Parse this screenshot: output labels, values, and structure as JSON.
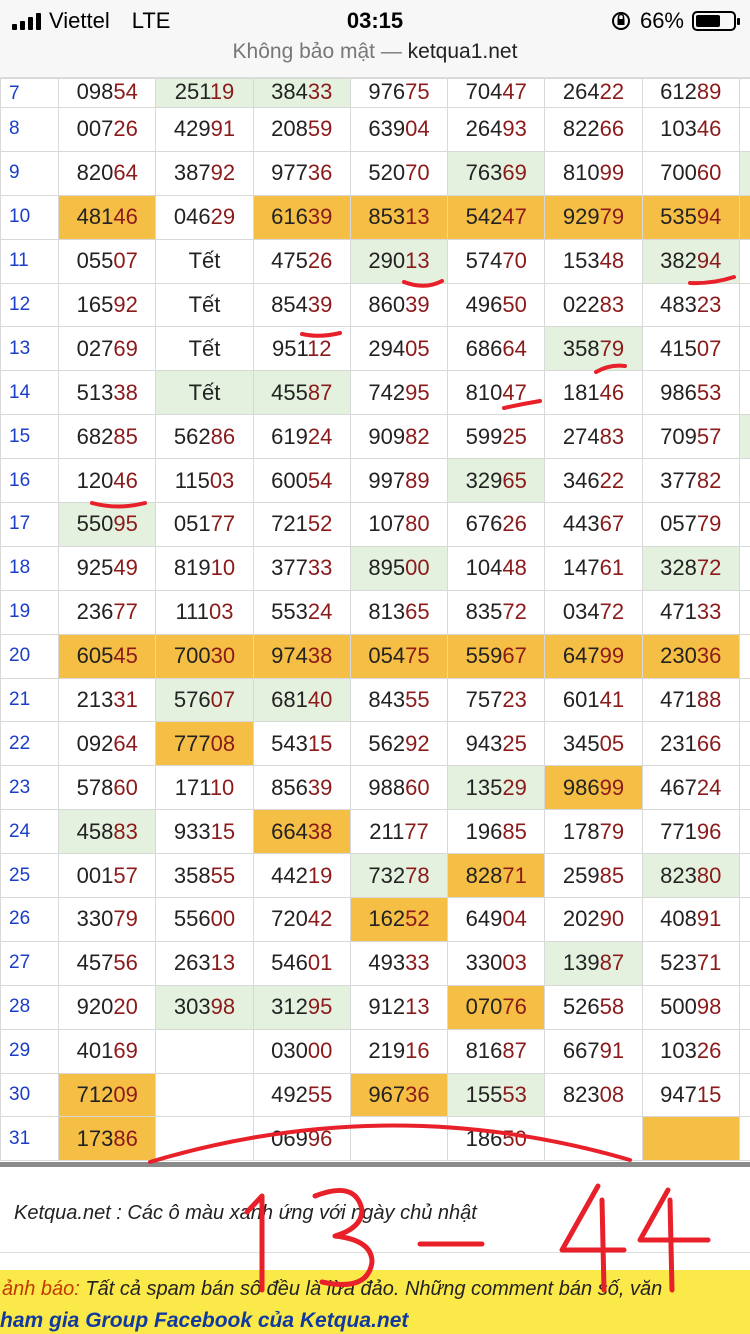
{
  "status_bar": {
    "carrier": "Viettel",
    "network": "LTE",
    "time": "03:15",
    "battery": "66%",
    "battery_level": 0.66
  },
  "url_bar": {
    "security": "Không bảo mật —",
    "host": "ketqua1.net"
  },
  "table": {
    "rows": [
      {
        "day": "7",
        "cells": [
          [
            "098",
            "54",
            ""
          ],
          [
            "251",
            "19",
            "g"
          ],
          [
            "384",
            "33",
            "g"
          ],
          [
            "976",
            "75",
            ""
          ],
          [
            "704",
            "47",
            ""
          ],
          [
            "264",
            "22",
            ""
          ],
          [
            "612",
            "89",
            ""
          ]
        ]
      },
      {
        "day": "8",
        "cells": [
          [
            "007",
            "26",
            ""
          ],
          [
            "429",
            "91",
            ""
          ],
          [
            "208",
            "59",
            ""
          ],
          [
            "639",
            "04",
            ""
          ],
          [
            "264",
            "93",
            ""
          ],
          [
            "822",
            "66",
            ""
          ],
          [
            "103",
            "46",
            ""
          ]
        ]
      },
      {
        "day": "9",
        "cells": [
          [
            "820",
            "64",
            ""
          ],
          [
            "387",
            "92",
            ""
          ],
          [
            "977",
            "36",
            ""
          ],
          [
            "520",
            "70",
            ""
          ],
          [
            "763",
            "69",
            "g"
          ],
          [
            "810",
            "99",
            ""
          ],
          [
            "700",
            "60",
            ""
          ]
        ]
      },
      {
        "day": "10",
        "cells": [
          [
            "481",
            "46",
            "y"
          ],
          [
            "046",
            "29",
            ""
          ],
          [
            "616",
            "39",
            "y"
          ],
          [
            "853",
            "13",
            "y"
          ],
          [
            "542",
            "47",
            "y"
          ],
          [
            "929",
            "79",
            "y"
          ],
          [
            "535",
            "94",
            "y"
          ]
        ]
      },
      {
        "day": "11",
        "cells": [
          [
            "055",
            "07",
            ""
          ],
          [
            "Tết",
            "",
            "t"
          ],
          [
            "475",
            "26",
            ""
          ],
          [
            "290",
            "13",
            "g"
          ],
          [
            "574",
            "70",
            ""
          ],
          [
            "153",
            "48",
            ""
          ],
          [
            "382",
            "94",
            "g"
          ]
        ]
      },
      {
        "day": "12",
        "cells": [
          [
            "165",
            "92",
            ""
          ],
          [
            "Tết",
            "",
            "t"
          ],
          [
            "854",
            "39",
            ""
          ],
          [
            "860",
            "39",
            ""
          ],
          [
            "496",
            "50",
            ""
          ],
          [
            "022",
            "83",
            ""
          ],
          [
            "483",
            "23",
            ""
          ]
        ]
      },
      {
        "day": "13",
        "cells": [
          [
            "027",
            "69",
            ""
          ],
          [
            "Tết",
            "",
            "t"
          ],
          [
            "951",
            "12",
            ""
          ],
          [
            "294",
            "05",
            ""
          ],
          [
            "686",
            "64",
            ""
          ],
          [
            "358",
            "79",
            "g"
          ],
          [
            "415",
            "07",
            ""
          ]
        ]
      },
      {
        "day": "14",
        "cells": [
          [
            "513",
            "38",
            ""
          ],
          [
            "Tết",
            "",
            "tg"
          ],
          [
            "455",
            "87",
            "g"
          ],
          [
            "742",
            "95",
            ""
          ],
          [
            "810",
            "47",
            ""
          ],
          [
            "181",
            "46",
            ""
          ],
          [
            "986",
            "53",
            ""
          ]
        ]
      },
      {
        "day": "15",
        "cells": [
          [
            "682",
            "85",
            ""
          ],
          [
            "562",
            "86",
            ""
          ],
          [
            "619",
            "24",
            ""
          ],
          [
            "909",
            "82",
            ""
          ],
          [
            "599",
            "25",
            ""
          ],
          [
            "274",
            "83",
            ""
          ],
          [
            "709",
            "57",
            ""
          ]
        ]
      },
      {
        "day": "16",
        "cells": [
          [
            "120",
            "46",
            ""
          ],
          [
            "115",
            "03",
            ""
          ],
          [
            "600",
            "54",
            ""
          ],
          [
            "997",
            "89",
            ""
          ],
          [
            "329",
            "65",
            "g"
          ],
          [
            "346",
            "22",
            ""
          ],
          [
            "377",
            "82",
            ""
          ]
        ]
      },
      {
        "day": "17",
        "cells": [
          [
            "550",
            "95",
            "g"
          ],
          [
            "051",
            "77",
            ""
          ],
          [
            "721",
            "52",
            ""
          ],
          [
            "107",
            "80",
            ""
          ],
          [
            "676",
            "26",
            ""
          ],
          [
            "443",
            "67",
            ""
          ],
          [
            "057",
            "79",
            ""
          ]
        ]
      },
      {
        "day": "18",
        "cells": [
          [
            "925",
            "49",
            ""
          ],
          [
            "819",
            "10",
            ""
          ],
          [
            "377",
            "33",
            ""
          ],
          [
            "895",
            "00",
            "g"
          ],
          [
            "104",
            "48",
            ""
          ],
          [
            "147",
            "61",
            ""
          ],
          [
            "328",
            "72",
            "g"
          ]
        ]
      },
      {
        "day": "19",
        "cells": [
          [
            "236",
            "77",
            ""
          ],
          [
            "111",
            "03",
            ""
          ],
          [
            "553",
            "24",
            ""
          ],
          [
            "813",
            "65",
            ""
          ],
          [
            "835",
            "72",
            ""
          ],
          [
            "034",
            "72",
            ""
          ],
          [
            "471",
            "33",
            ""
          ]
        ]
      },
      {
        "day": "20",
        "cells": [
          [
            "605",
            "45",
            "y"
          ],
          [
            "700",
            "30",
            "y"
          ],
          [
            "974",
            "38",
            "y"
          ],
          [
            "054",
            "75",
            "y"
          ],
          [
            "559",
            "67",
            "y"
          ],
          [
            "647",
            "99",
            "y"
          ],
          [
            "230",
            "36",
            "y"
          ]
        ]
      },
      {
        "day": "21",
        "cells": [
          [
            "213",
            "31",
            ""
          ],
          [
            "576",
            "07",
            "g"
          ],
          [
            "681",
            "40",
            "g"
          ],
          [
            "843",
            "55",
            ""
          ],
          [
            "757",
            "23",
            ""
          ],
          [
            "601",
            "41",
            ""
          ],
          [
            "471",
            "88",
            ""
          ]
        ]
      },
      {
        "day": "22",
        "cells": [
          [
            "092",
            "64",
            ""
          ],
          [
            "777",
            "08",
            "y"
          ],
          [
            "543",
            "15",
            ""
          ],
          [
            "562",
            "92",
            ""
          ],
          [
            "943",
            "25",
            ""
          ],
          [
            "345",
            "05",
            ""
          ],
          [
            "231",
            "66",
            ""
          ]
        ]
      },
      {
        "day": "23",
        "cells": [
          [
            "578",
            "60",
            ""
          ],
          [
            "171",
            "10",
            ""
          ],
          [
            "856",
            "39",
            ""
          ],
          [
            "988",
            "60",
            ""
          ],
          [
            "135",
            "29",
            "g"
          ],
          [
            "986",
            "99",
            "y"
          ],
          [
            "467",
            "24",
            ""
          ]
        ]
      },
      {
        "day": "24",
        "cells": [
          [
            "458",
            "83",
            "g"
          ],
          [
            "933",
            "15",
            ""
          ],
          [
            "664",
            "38",
            "y"
          ],
          [
            "211",
            "77",
            ""
          ],
          [
            "196",
            "85",
            ""
          ],
          [
            "178",
            "79",
            ""
          ],
          [
            "771",
            "96",
            ""
          ]
        ]
      },
      {
        "day": "25",
        "cells": [
          [
            "001",
            "57",
            ""
          ],
          [
            "358",
            "55",
            ""
          ],
          [
            "442",
            "19",
            ""
          ],
          [
            "732",
            "78",
            "g"
          ],
          [
            "828",
            "71",
            "y"
          ],
          [
            "259",
            "85",
            ""
          ],
          [
            "823",
            "80",
            "g"
          ]
        ]
      },
      {
        "day": "26",
        "cells": [
          [
            "330",
            "79",
            ""
          ],
          [
            "556",
            "00",
            ""
          ],
          [
            "720",
            "42",
            ""
          ],
          [
            "162",
            "52",
            "y"
          ],
          [
            "649",
            "04",
            ""
          ],
          [
            "202",
            "90",
            ""
          ],
          [
            "408",
            "91",
            ""
          ]
        ]
      },
      {
        "day": "27",
        "cells": [
          [
            "457",
            "56",
            ""
          ],
          [
            "263",
            "13",
            ""
          ],
          [
            "546",
            "01",
            ""
          ],
          [
            "493",
            "33",
            ""
          ],
          [
            "330",
            "03",
            ""
          ],
          [
            "139",
            "87",
            "g"
          ],
          [
            "523",
            "71",
            ""
          ]
        ]
      },
      {
        "day": "28",
        "cells": [
          [
            "920",
            "20",
            ""
          ],
          [
            "303",
            "98",
            "g"
          ],
          [
            "312",
            "95",
            "g"
          ],
          [
            "912",
            "13",
            ""
          ],
          [
            "070",
            "76",
            "y"
          ],
          [
            "526",
            "58",
            ""
          ],
          [
            "500",
            "98",
            ""
          ]
        ]
      },
      {
        "day": "29",
        "cells": [
          [
            "401",
            "69",
            ""
          ],
          [
            "",
            "",
            ""
          ],
          [
            "030",
            "00",
            ""
          ],
          [
            "219",
            "16",
            ""
          ],
          [
            "816",
            "87",
            ""
          ],
          [
            "667",
            "91",
            ""
          ],
          [
            "103",
            "26",
            ""
          ]
        ]
      },
      {
        "day": "30",
        "cells": [
          [
            "712",
            "09",
            "y"
          ],
          [
            "",
            "",
            ""
          ],
          [
            "492",
            "55",
            ""
          ],
          [
            "967",
            "36",
            "y"
          ],
          [
            "155",
            "53",
            "g"
          ],
          [
            "823",
            "08",
            ""
          ],
          [
            "947",
            "15",
            ""
          ]
        ]
      },
      {
        "day": "31",
        "cells": [
          [
            "173",
            "86",
            "y"
          ],
          [
            "",
            "",
            ""
          ],
          [
            "069",
            "96",
            ""
          ],
          [
            "",
            "",
            ""
          ],
          [
            "186",
            "50",
            ""
          ],
          [
            "",
            "",
            ""
          ],
          [
            "",
            "",
            "y"
          ]
        ]
      }
    ]
  },
  "footer": {
    "note": "Ketqua.net : Các ô màu xanh ứng với ngày chủ nhật",
    "warning_label": "ảnh báo:",
    "warning_text": " Tất cả spam bán số đều là lừa đảo. Những comment bán số, văn",
    "join": "ham gia Group Facebook của Ketqua.net"
  },
  "handwriting": {
    "text": "13 - 44"
  },
  "colors": {
    "green": "#e4f1de",
    "yellow": "#f5be45",
    "ink": "#e8202a",
    "day": "#1a3ec8",
    "tail": "#8b1a1a"
  }
}
